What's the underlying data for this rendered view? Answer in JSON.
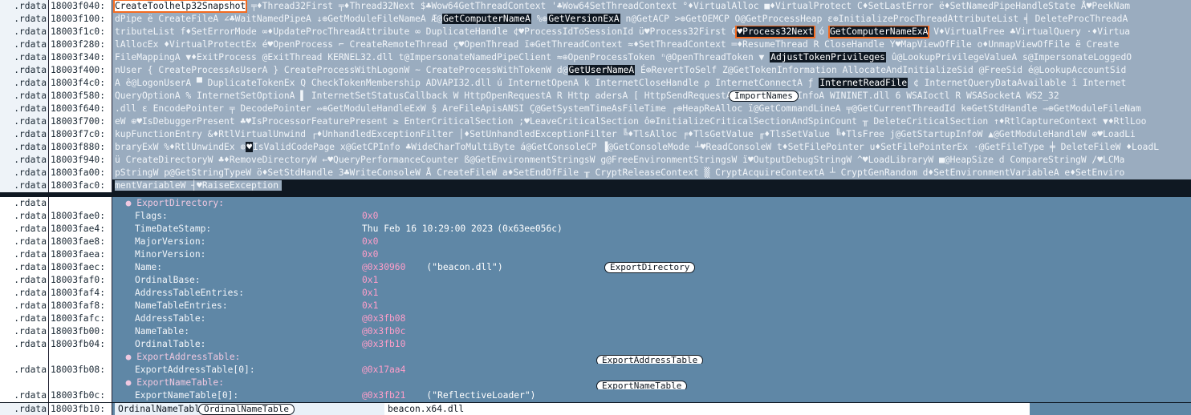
{
  "hex": {
    "segment": ".rdata",
    "rows": [
      {
        "addr": "18003f040:",
        "parts": [
          {
            "t": "CreateToolhelp32Snapshot",
            "c": "box"
          },
          {
            "t": " ╤♦Thread32First ╤♦Thread32Next  $♣Wow64GetThreadContext '♣Wow64SetThreadContext °♦VirtualAlloc  ■♦VirtualProtect  C♦SetLastError  ë♦SetNamedPipeHandleState Å♥PeekNam"
          }
        ]
      },
      {
        "addr": "18003f100:",
        "parts": [
          {
            "t": "dPipe ë CreateFileA ∠♣WaitNamedPipeA  ↓⊕GetModuleFileNameA  Æ@"
          },
          {
            "t": "GetComputerNameA",
            "c": "hl"
          },
          {
            "t": "  %⊕"
          },
          {
            "t": "GetVersionExA",
            "c": "hl"
          },
          {
            "t": " n@GetACP  >⊕GetOEMCP  O@GetProcessHeap  ε⊕InitializeProcThreadAttributeList ╡ DeleteProcThreadA"
          }
        ]
      },
      {
        "addr": "18003f1c0:",
        "parts": [
          {
            "t": "tributeList f♦SetErrorMode  ∞♦UpdateProcThreadAttribute ∞ DuplicateHandle ¢♥ProcessIdToSessionId  ü♥Process32First  C"
          },
          {
            "t": "♥Process32Next",
            "c": "box dark"
          },
          {
            "t": " ó "
          },
          {
            "t": "GetComputerNameExA",
            "c": "box dark"
          },
          {
            "t": "  V♦VirtualFree  ♣VirtualQuery  ·♦Virtua"
          }
        ]
      },
      {
        "addr": "18003f280:",
        "parts": [
          {
            "t": "lAllocEx   ♦VirtualProtectEx  é♥OpenProcess ⌐ CreateRemoteThread  ç♥OpenThread  ï⊕GetThreadContext  ≈♦SetThreadContext  ═♦ResumeThread  R CloseHandle Y♥MapViewOfFile ο♦UnmapViewOfFile ë Create"
          }
        ]
      },
      {
        "addr": "18003f340:",
        "parts": [
          {
            "t": "FileMappingA  ▼♦ExitProcess  @ExitThread  KERNEL32.dll  t@ImpersonateNamedPipeClient  ≈⊕OpenProcessToken  ⁿ@OpenThreadToken ▼ "
          },
          {
            "t": "AdjustTokenPrivileges",
            "c": "hl"
          },
          {
            "t": " û@LookupPrivilegeValueA s@ImpersonateLoggedO"
          }
        ]
      },
      {
        "addr": "18003f400:",
        "parts": [
          {
            "t": "nUser { CreateProcessAsUserA  } CreateProcessWithLogonW ~ CreateProcessWithTokenW d@"
          },
          {
            "t": "GetUserNameA",
            "c": "hl"
          },
          {
            "t": "  É⊕RevertToSelf  Z@GetTokenInformation   AllocateAndInitializeSid   @FreeSid é@LookupAccountSid"
          }
        ]
      },
      {
        "addr": "18003f4c0:",
        "parts": [
          {
            "t": "A ê@LogonUserA  ▀ DuplicateTokenEx  Q CheckTokenMembership  ADVAPI32.dll  ú InternetOpenA k InternetCloseHandle ρ InternetConnectA  ƒ "
          },
          {
            "t": "InternetReadFile",
            "c": "hl"
          },
          {
            "t": "  ¢ InternetQueryDataAvailable  ǐ Internet"
          }
        ]
      },
      {
        "addr": "18003f580:",
        "parts": [
          {
            "t": "QueryOptionA  % InternetSetOptionA  ▌ InternetSetStatusCallback W HttpOpenRequestA  R Http"
          },
          {
            "t": "              ",
            "c": "pillslot"
          },
          {
            "t": "adersA  [ HttpSendRequestA  Y HttpQueryInfoA  WININET.dll 6 WSAIoctl  R WSASocketA  WS2_32"
          }
        ],
        "pill": "ImportNames"
      },
      {
        "addr": "18003f640:",
        "parts": [
          {
            "t": ".dll  ε EncodePointer ╤ DecodePointer ⇔⊕GetModuleHandleExW  § AreFileApisANSI Ç@GetSystemTimeAsFileTime ┌⊕HeapReAlloc ï@GetCommandLineA ╤@GetCurrentThreadId  k⊕GetStdHandle  ⇒⊕GetModuleFileNam"
          }
        ]
      },
      {
        "addr": "18003f700:",
        "parts": [
          {
            "t": "eW  ⊕♥IsDebuggerPresent ♣♥IsProcessorFeaturePresent ≥ EnterCriticalSection  ;♥LeaveCriticalSection  ô⊕InitializeCriticalSectionAndSpinCount ╥ DeleteCriticalSection ↑♦RtlCaptureContext ▼♦RtlLoo"
          }
        ]
      },
      {
        "addr": "18003f7c0:",
        "parts": [
          {
            "t": "kupFunctionEntry  &♦RtlVirtualUnwind ┌♦UnhandledExceptionFilter  │♦SetUnhandledExceptionFilter ╚♦TlsAlloc  ╒♦TlsGetValue ╓♦TlsSetValue ╚♦TlsFree j@GetStartupInfoW ▲@GetModuleHandleW  ⊕♥LoadLi"
          }
        ]
      },
      {
        "addr": "18003f880:",
        "parts": [
          {
            "t": "braryExW  %♦RtlUnwindEx ⊕"
          },
          {
            "t": "♥",
            "c": "hl"
          },
          {
            "t": "IsValidCodePage x@GetCPInfo  ♣WideCharToMultiByte á@GetConsoleCP  ▐@GetConsoleMode  ┴♥ReadConsoleW  t♦SetFilePointer  u♦SetFilePointerEx  ·@GetFileType ╪ DeleteFileW  ♦LoadL"
          }
        ]
      },
      {
        "addr": "18003f940:",
        "parts": [
          {
            "t": "ü CreateDirectoryW  ♣♦RemoveDirectoryW  ←♥QueryPerformanceCounter ß@GetEnvironmentStringsW  g@FreeEnvironmentStringsW ï♥OutputDebugStringW  ^♥LoadLibraryW  ■@HeapSize  d CompareStringW  /♥LCMa"
          }
        ]
      },
      {
        "addr": "18003fa00:",
        "parts": [
          {
            "t": "pStringW  p@GetStringTypeW  ö♦SetStdHandle  3♣WriteConsoleW Å CreateFileW  a♦SetEndOfFile  ╥ CryptReleaseContext ▒ CryptAcquireContextA  ┴ CryptGenRandom  d♦SetEnvironmentVariableA e♦SetEnviro"
          }
        ]
      },
      {
        "addr": "18003fac0:",
        "parts": [
          {
            "t": "mentVariableW ┤♥RaiseException  "
          }
        ],
        "tail": true
      }
    ]
  },
  "export_directory": {
    "header": "ExportDirectory:",
    "addr_head": "18003fae0:",
    "pill": "ExportDirectory",
    "fields": [
      {
        "addr": "18003fae0:",
        "key": "Flags:",
        "value": "0x0",
        "detail": ""
      },
      {
        "addr": "18003fae4:",
        "key": "TimeDateStamp:",
        "value": "Thu Feb 16 10:29:00 2023",
        "detail": "(0x63ee056c)"
      },
      {
        "addr": "18003fae8:",
        "key": "MajorVersion:",
        "value": "0x0",
        "detail": ""
      },
      {
        "addr": "18003faea:",
        "key": "MinorVersion:",
        "value": "0x0",
        "detail": ""
      },
      {
        "addr": "18003faec:",
        "key": "Name:",
        "value": "@0x30960",
        "detail": "(\"beacon.dll\")"
      },
      {
        "addr": "18003faf0:",
        "key": "OrdinalBase:",
        "value": "0x1",
        "detail": ""
      },
      {
        "addr": "18003faf4:",
        "key": "AddressTableEntries:",
        "value": "0x1",
        "detail": ""
      },
      {
        "addr": "18003faf8:",
        "key": "NameTableEntries:",
        "value": "0x1",
        "detail": ""
      },
      {
        "addr": "18003fafc:",
        "key": "AddressTable:",
        "value": "@0x3fb08",
        "detail": ""
      },
      {
        "addr": "18003fb00:",
        "key": "NameTable:",
        "value": "@0x3fb0c",
        "detail": ""
      },
      {
        "addr": "18003fb04:",
        "key": "OrdinalTable:",
        "value": "@0x3fb10",
        "detail": ""
      }
    ]
  },
  "export_address_table": {
    "header": "ExportAddressTable:",
    "pill": "ExportAddressTable",
    "field": {
      "addr": "18003fb08:",
      "key": "ExportAddressTable[0]:",
      "value": "@0x17aa4",
      "detail": ""
    }
  },
  "export_name_table": {
    "header": "ExportNameTable:",
    "pill": "ExportNameTable",
    "field": {
      "addr": "18003fb0c:",
      "key": "ExportNameTable[0]:",
      "value": "@0x3fb21",
      "detail": "(\"ReflectiveLoader\")"
    }
  },
  "last_row": {
    "addr": "18003fb10:",
    "label": "OrdinalNameTabl",
    "pill": "OrdinalNameTable",
    "value": "beacon.x64.dll"
  },
  "colors": {
    "highlight_box": "#f36b21",
    "hex_bg": "#9aacbf",
    "struct_bg": "#5f87a6",
    "value_color": "#ff9ec9"
  }
}
